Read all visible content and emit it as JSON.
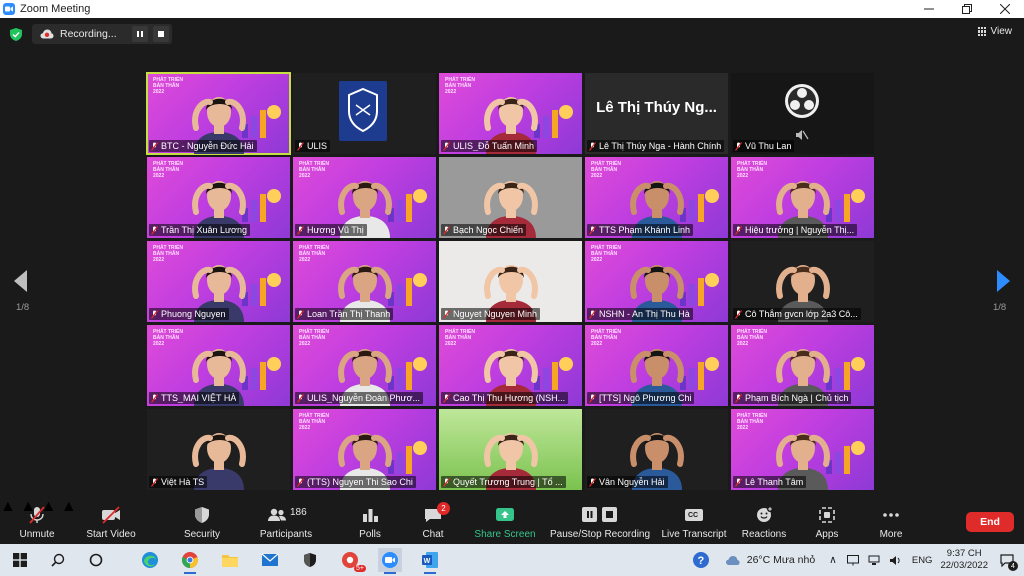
{
  "window": {
    "title": "Zoom Meeting",
    "minimize_icon": "minimize-icon",
    "maximize_icon": "restore-icon",
    "close_icon": "close-icon"
  },
  "top": {
    "recording_text": "Recording...",
    "view_label": "View"
  },
  "nav": {
    "page_left": "1/8",
    "page_right": "1/8"
  },
  "tiles": [
    {
      "name": "BTC - Nguyễn Đức Hải",
      "bg": "purple",
      "active": true
    },
    {
      "name": "ULIS",
      "bg": "dark",
      "logo": "ulis-logo"
    },
    {
      "name": "ULIS_Đỗ Tuấn Minh",
      "bg": "purple"
    },
    {
      "name": "Lê Thị Thúy Nga - Hành Chính",
      "bg": "dark2",
      "big_name": "Lê Thị Thúy Ng..."
    },
    {
      "name": "Vũ Thu Lan",
      "bg": "black",
      "logo": "obs-logo"
    },
    {
      "name": "Trần Thị Xuân Lương",
      "bg": "purple"
    },
    {
      "name": "Hương Vũ Thị",
      "bg": "purple"
    },
    {
      "name": "Bạch Ngọc Chiến",
      "bg": "gray"
    },
    {
      "name": "TTS Phạm Khánh Linh",
      "bg": "purple"
    },
    {
      "name": "Hiệu trưởng | Nguyễn Thị...",
      "bg": "purple"
    },
    {
      "name": "Phuong Nguyen",
      "bg": "purple"
    },
    {
      "name": "Loan Trần Thị Thanh",
      "bg": "purple"
    },
    {
      "name": "Nguyet Nguyen Minh",
      "bg": "white"
    },
    {
      "name": "NSHN - An Thị Thu Hà",
      "bg": "purple"
    },
    {
      "name": "Cô Thắm gvcn lớp 2a3 Cô...",
      "bg": "dark"
    },
    {
      "name": "TTS_MAI VIỆT HÀ",
      "bg": "purple"
    },
    {
      "name": "ULIS_Nguyễn Đoàn Phươ...",
      "bg": "purple"
    },
    {
      "name": "Cao Thị Thu Hương (NSH...",
      "bg": "purple"
    },
    {
      "name": "[TTS] Ngô Phương Chi",
      "bg": "purple"
    },
    {
      "name": "Phạm Bích Ngà | Chủ tịch",
      "bg": "purple"
    },
    {
      "name": "Việt Hà TS",
      "bg": "dark"
    },
    {
      "name": "(TTS) Nguyen Thi Sao Chi",
      "bg": "purple"
    },
    {
      "name": "Quyết Trương Trung | Tổ ...",
      "bg": "green"
    },
    {
      "name": "Vân Nguyễn Hải",
      "bg": "dark"
    },
    {
      "name": "Lê Thanh Tâm",
      "bg": "purple"
    }
  ],
  "banner": {
    "line1": "PHÁT TRIỂN",
    "line2": "BẢN THÂN",
    "line3": "2022"
  },
  "toolbar": {
    "unmute": "Unmute",
    "start_video": "Start Video",
    "security": "Security",
    "participants": "Participants",
    "participants_count": "186",
    "polls": "Polls",
    "chat": "Chat",
    "chat_badge": "2",
    "share_screen": "Share Screen",
    "pause_recording": "Pause/Stop Recording",
    "live_transcript": "Live Transcript",
    "cc_text": "CC",
    "reactions": "Reactions",
    "apps": "Apps",
    "more": "More",
    "end": "End"
  },
  "taskbar": {
    "weather": "26°C  Mưa nhỏ",
    "lang": "ENG",
    "time": "9:37 CH",
    "date": "22/03/2022",
    "notif_count": "4",
    "app_badge": "5+"
  },
  "colors": {
    "accent_green": "#35c58b",
    "end_red": "#e02b2b",
    "active_speaker": "#c6e041",
    "zoom_blue": "#2d8cff"
  }
}
